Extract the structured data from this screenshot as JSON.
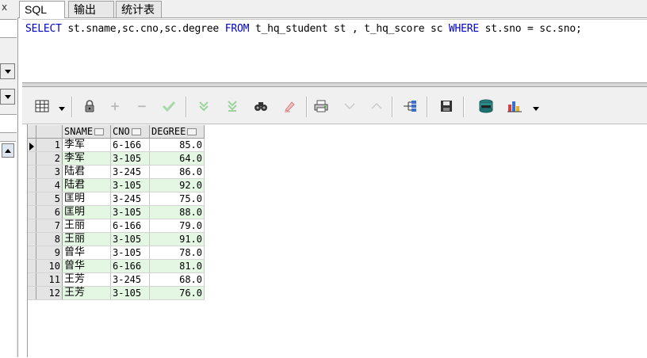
{
  "tabs": [
    {
      "label": "SQL",
      "active": true
    },
    {
      "label": "输出",
      "active": false
    },
    {
      "label": "统计表",
      "active": false
    }
  ],
  "left_strip": {
    "close_glyph": "x"
  },
  "editor": {
    "sql": {
      "p1_kw": "SELECT",
      "p2": " st.sname,sc.cno,sc.degree ",
      "p3_kw": "FROM",
      "p4": " t_hq_student st , t_hq_score sc ",
      "p5_kw": "WHERE",
      "p6": " st.sno = sc.sno;"
    }
  },
  "toolbar": {
    "icons": [
      "grid-view-icon",
      "lock-icon",
      "add-record-icon",
      "delete-record-icon",
      "post-changes-icon",
      "fetch-next-icon",
      "fetch-last-icon",
      "find-icon",
      "clear-icon",
      "print-icon",
      "sort-desc-icon",
      "sort-asc-icon",
      "query-by-example-icon",
      "save-icon",
      "export-icon",
      "chart-icon"
    ]
  },
  "grid": {
    "columns": [
      "SNAME",
      "CNO",
      "DEGREE"
    ],
    "rows": [
      {
        "n": "1",
        "sname": "李军",
        "cno": "6-166",
        "degree": "85.0"
      },
      {
        "n": "2",
        "sname": "李军",
        "cno": "3-105",
        "degree": "64.0"
      },
      {
        "n": "3",
        "sname": "陆君",
        "cno": "3-245",
        "degree": "86.0"
      },
      {
        "n": "4",
        "sname": "陆君",
        "cno": "3-105",
        "degree": "92.0"
      },
      {
        "n": "5",
        "sname": "匡明",
        "cno": "3-245",
        "degree": "75.0"
      },
      {
        "n": "6",
        "sname": "匡明",
        "cno": "3-105",
        "degree": "88.0"
      },
      {
        "n": "7",
        "sname": "王丽",
        "cno": "6-166",
        "degree": "79.0"
      },
      {
        "n": "8",
        "sname": "王丽",
        "cno": "3-105",
        "degree": "91.0"
      },
      {
        "n": "9",
        "sname": "曾华",
        "cno": "3-105",
        "degree": "78.0"
      },
      {
        "n": "10",
        "sname": "曾华",
        "cno": "6-166",
        "degree": "81.0"
      },
      {
        "n": "11",
        "sname": "王芳",
        "cno": "3-245",
        "degree": "68.0"
      },
      {
        "n": "12",
        "sname": "王芳",
        "cno": "3-105",
        "degree": "76.0"
      }
    ]
  },
  "colors": {
    "keyword": "#0000cc",
    "row_alt": "#e3f7e3",
    "header_bg": "#e4e4e4"
  }
}
